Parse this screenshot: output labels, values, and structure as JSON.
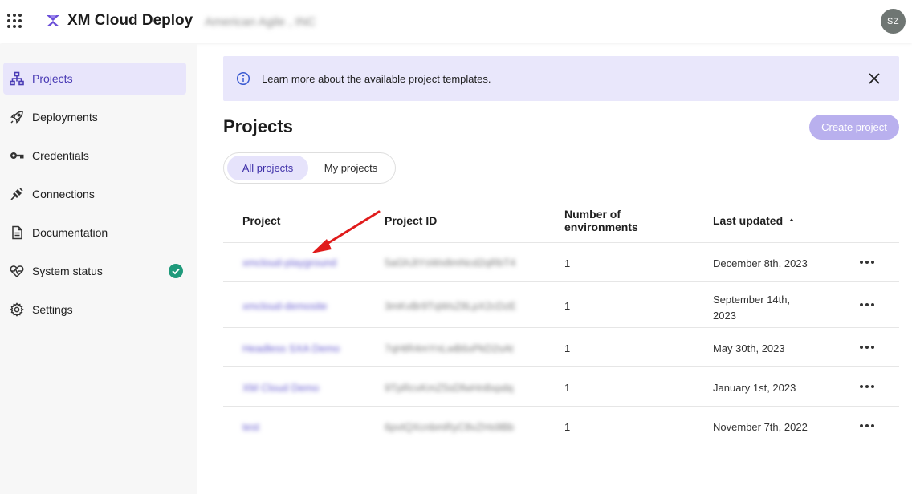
{
  "header": {
    "app_title": "XM Cloud Deploy",
    "org_name": "American Agile , INC",
    "avatar_initials": "SZ",
    "brand_color": "#6b4fd8"
  },
  "sidebar": {
    "items": [
      {
        "label": "Projects",
        "icon": "sitemap-icon",
        "active": true
      },
      {
        "label": "Deployments",
        "icon": "rocket-icon"
      },
      {
        "label": "Credentials",
        "icon": "key-icon"
      },
      {
        "label": "Connections",
        "icon": "plug-icon"
      },
      {
        "label": "Documentation",
        "icon": "document-icon"
      },
      {
        "label": "System status",
        "icon": "heartbeat-icon",
        "status": "operational",
        "status_color": "#1f9a7b"
      },
      {
        "label": "Settings",
        "icon": "gear-icon"
      }
    ]
  },
  "banner": {
    "text": "Learn more about the available project templates."
  },
  "main": {
    "title": "Projects",
    "create_label": "Create project",
    "tabs": [
      {
        "label": "All projects",
        "active": true
      },
      {
        "label": "My projects"
      }
    ],
    "table": {
      "columns": [
        "Project",
        "Project ID",
        "Number of environments",
        "Last updated"
      ],
      "sort_column": "Last updated",
      "rows": [
        {
          "name": "xmcloud-playground",
          "id": "5aGhJtYsWx8mNcd2qRbT4",
          "environments": "1",
          "updated": "December 8th, 2023"
        },
        {
          "name": "xmcloud-demosite",
          "id": "3mKvBr9TqWsZ8LpX2cDzE",
          "environments": "1",
          "updated": "September 14th, 2023"
        },
        {
          "name": "Headless SXA Demo",
          "id": "7qHtR4mYnLwB6xPkD2sAt",
          "environments": "1",
          "updated": "May 30th, 2023"
        },
        {
          "name": "XM Cloud Demo",
          "id": "9TpRcvKmZ5sDfwHn8xpdq",
          "environments": "1",
          "updated": "January 1st, 2023"
        },
        {
          "name": "test",
          "id": "6pvtQXcnbmRyC8vZHs9Bb",
          "environments": "1",
          "updated": "November 7th, 2022"
        }
      ]
    }
  }
}
